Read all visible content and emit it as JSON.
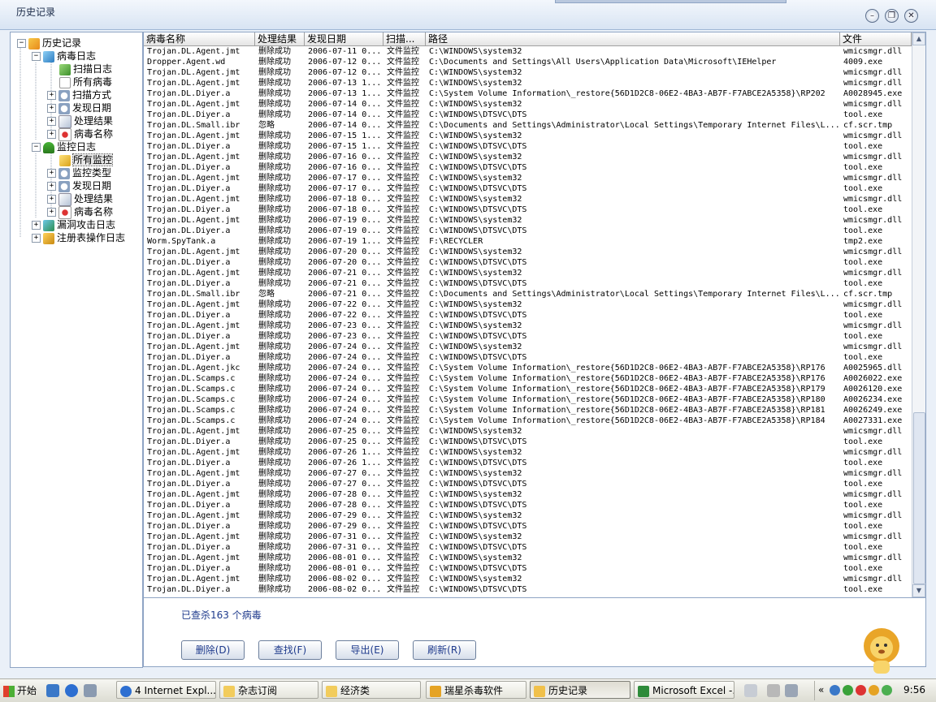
{
  "window": {
    "title": "历史记录"
  },
  "tree": {
    "root": "历史记录",
    "nodes": [
      {
        "label": "病毒日志"
      },
      {
        "label": "扫描日志"
      },
      {
        "label": "所有病毒"
      },
      {
        "label": "扫描方式"
      },
      {
        "label": "发现日期"
      },
      {
        "label": "处理结果"
      },
      {
        "label": "病毒名称"
      },
      {
        "label": "监控日志"
      },
      {
        "label": "所有监控"
      },
      {
        "label": "监控类型"
      },
      {
        "label": "发现日期"
      },
      {
        "label": "处理结果"
      },
      {
        "label": "病毒名称"
      },
      {
        "label": "漏洞攻击日志"
      },
      {
        "label": "注册表操作日志"
      }
    ]
  },
  "table": {
    "columns": [
      "病毒名称",
      "处理结果",
      "发现日期",
      "扫描...",
      "路径",
      "文件"
    ],
    "rows": [
      [
        "Trojan.DL.Agent.jmt",
        "删除成功",
        "2006-07-11 0...",
        "文件监控",
        "C:\\WINDOWS\\system32",
        "wmicsmgr.dll"
      ],
      [
        "Dropper.Agent.wd",
        "删除成功",
        "2006-07-12 0...",
        "文件监控",
        "C:\\Documents and Settings\\All Users\\Application Data\\Microsoft\\IEHelper",
        "4009.exe"
      ],
      [
        "Trojan.DL.Agent.jmt",
        "删除成功",
        "2006-07-12 0...",
        "文件监控",
        "C:\\WINDOWS\\system32",
        "wmicsmgr.dll"
      ],
      [
        "Trojan.DL.Agent.jmt",
        "删除成功",
        "2006-07-13 1...",
        "文件监控",
        "C:\\WINDOWS\\system32",
        "wmicsmgr.dll"
      ],
      [
        "Trojan.DL.Diyer.a",
        "删除成功",
        "2006-07-13 1...",
        "文件监控",
        "C:\\System Volume Information\\_restore{56D1D2C8-06E2-4BA3-AB7F-F7ABCE2A5358}\\RP202",
        "A0028945.exe"
      ],
      [
        "Trojan.DL.Agent.jmt",
        "删除成功",
        "2006-07-14 0...",
        "文件监控",
        "C:\\WINDOWS\\system32",
        "wmicsmgr.dll"
      ],
      [
        "Trojan.DL.Diyer.a",
        "删除成功",
        "2006-07-14 0...",
        "文件监控",
        "C:\\WINDOWS\\DTSVC\\DTS",
        "tool.exe"
      ],
      [
        "Trojan.DL.Small.ibr",
        "忽略",
        "2006-07-14 0...",
        "文件监控",
        "C:\\Documents and Settings\\Administrator\\Local Settings\\Temporary Internet Files\\L...",
        "cf.scr.tmp"
      ],
      [
        "Trojan.DL.Agent.jmt",
        "删除成功",
        "2006-07-15 1...",
        "文件监控",
        "C:\\WINDOWS\\system32",
        "wmicsmgr.dll"
      ],
      [
        "Trojan.DL.Diyer.a",
        "删除成功",
        "2006-07-15 1...",
        "文件监控",
        "C:\\WINDOWS\\DTSVC\\DTS",
        "tool.exe"
      ],
      [
        "Trojan.DL.Agent.jmt",
        "删除成功",
        "2006-07-16 0...",
        "文件监控",
        "C:\\WINDOWS\\system32",
        "wmicsmgr.dll"
      ],
      [
        "Trojan.DL.Diyer.a",
        "删除成功",
        "2006-07-16 0...",
        "文件监控",
        "C:\\WINDOWS\\DTSVC\\DTS",
        "tool.exe"
      ],
      [
        "Trojan.DL.Agent.jmt",
        "删除成功",
        "2006-07-17 0...",
        "文件监控",
        "C:\\WINDOWS\\system32",
        "wmicsmgr.dll"
      ],
      [
        "Trojan.DL.Diyer.a",
        "删除成功",
        "2006-07-17 0...",
        "文件监控",
        "C:\\WINDOWS\\DTSVC\\DTS",
        "tool.exe"
      ],
      [
        "Trojan.DL.Agent.jmt",
        "删除成功",
        "2006-07-18 0...",
        "文件监控",
        "C:\\WINDOWS\\system32",
        "wmicsmgr.dll"
      ],
      [
        "Trojan.DL.Diyer.a",
        "删除成功",
        "2006-07-18 0...",
        "文件监控",
        "C:\\WINDOWS\\DTSVC\\DTS",
        "tool.exe"
      ],
      [
        "Trojan.DL.Agent.jmt",
        "删除成功",
        "2006-07-19 0...",
        "文件监控",
        "C:\\WINDOWS\\system32",
        "wmicsmgr.dll"
      ],
      [
        "Trojan.DL.Diyer.a",
        "删除成功",
        "2006-07-19 0...",
        "文件监控",
        "C:\\WINDOWS\\DTSVC\\DTS",
        "tool.exe"
      ],
      [
        "Worm.SpyTank.a",
        "删除成功",
        "2006-07-19 1...",
        "文件监控",
        "F:\\RECYCLER",
        "tmp2.exe"
      ],
      [
        "Trojan.DL.Agent.jmt",
        "删除成功",
        "2006-07-20 0...",
        "文件监控",
        "C:\\WINDOWS\\system32",
        "wmicsmgr.dll"
      ],
      [
        "Trojan.DL.Diyer.a",
        "删除成功",
        "2006-07-20 0...",
        "文件监控",
        "C:\\WINDOWS\\DTSVC\\DTS",
        "tool.exe"
      ],
      [
        "Trojan.DL.Agent.jmt",
        "删除成功",
        "2006-07-21 0...",
        "文件监控",
        "C:\\WINDOWS\\system32",
        "wmicsmgr.dll"
      ],
      [
        "Trojan.DL.Diyer.a",
        "删除成功",
        "2006-07-21 0...",
        "文件监控",
        "C:\\WINDOWS\\DTSVC\\DTS",
        "tool.exe"
      ],
      [
        "Trojan.DL.Small.ibr",
        "忽略",
        "2006-07-21 0...",
        "文件监控",
        "C:\\Documents and Settings\\Administrator\\Local Settings\\Temporary Internet Files\\L...",
        "cf.scr.tmp"
      ],
      [
        "Trojan.DL.Agent.jmt",
        "删除成功",
        "2006-07-22 0...",
        "文件监控",
        "C:\\WINDOWS\\system32",
        "wmicsmgr.dll"
      ],
      [
        "Trojan.DL.Diyer.a",
        "删除成功",
        "2006-07-22 0...",
        "文件监控",
        "C:\\WINDOWS\\DTSVC\\DTS",
        "tool.exe"
      ],
      [
        "Trojan.DL.Agent.jmt",
        "删除成功",
        "2006-07-23 0...",
        "文件监控",
        "C:\\WINDOWS\\system32",
        "wmicsmgr.dll"
      ],
      [
        "Trojan.DL.Diyer.a",
        "删除成功",
        "2006-07-23 0...",
        "文件监控",
        "C:\\WINDOWS\\DTSVC\\DTS",
        "tool.exe"
      ],
      [
        "Trojan.DL.Agent.jmt",
        "删除成功",
        "2006-07-24 0...",
        "文件监控",
        "C:\\WINDOWS\\system32",
        "wmicsmgr.dll"
      ],
      [
        "Trojan.DL.Diyer.a",
        "删除成功",
        "2006-07-24 0...",
        "文件监控",
        "C:\\WINDOWS\\DTSVC\\DTS",
        "tool.exe"
      ],
      [
        "Trojan.DL.Agent.jkc",
        "删除成功",
        "2006-07-24 0...",
        "文件监控",
        "C:\\System Volume Information\\_restore{56D1D2C8-06E2-4BA3-AB7F-F7ABCE2A5358}\\RP176",
        "A0025965.dll"
      ],
      [
        "Trojan.DL.Scamps.c",
        "删除成功",
        "2006-07-24 0...",
        "文件监控",
        "C:\\System Volume Information\\_restore{56D1D2C8-06E2-4BA3-AB7F-F7ABCE2A5358}\\RP176",
        "A0026022.exe"
      ],
      [
        "Trojan.DL.Scamps.c",
        "删除成功",
        "2006-07-24 0...",
        "文件监控",
        "C:\\System Volume Information\\_restore{56D1D2C8-06E2-4BA3-AB7F-F7ABCE2A5358}\\RP179",
        "A0026120.exe"
      ],
      [
        "Trojan.DL.Scamps.c",
        "删除成功",
        "2006-07-24 0...",
        "文件监控",
        "C:\\System Volume Information\\_restore{56D1D2C8-06E2-4BA3-AB7F-F7ABCE2A5358}\\RP180",
        "A0026234.exe"
      ],
      [
        "Trojan.DL.Scamps.c",
        "删除成功",
        "2006-07-24 0...",
        "文件监控",
        "C:\\System Volume Information\\_restore{56D1D2C8-06E2-4BA3-AB7F-F7ABCE2A5358}\\RP181",
        "A0026249.exe"
      ],
      [
        "Trojan.DL.Scamps.c",
        "删除成功",
        "2006-07-24 0...",
        "文件监控",
        "C:\\System Volume Information\\_restore{56D1D2C8-06E2-4BA3-AB7F-F7ABCE2A5358}\\RP184",
        "A0027331.exe"
      ],
      [
        "Trojan.DL.Agent.jmt",
        "删除成功",
        "2006-07-25 0...",
        "文件监控",
        "C:\\WINDOWS\\system32",
        "wmicsmgr.dll"
      ],
      [
        "Trojan.DL.Diyer.a",
        "删除成功",
        "2006-07-25 0...",
        "文件监控",
        "C:\\WINDOWS\\DTSVC\\DTS",
        "tool.exe"
      ],
      [
        "Trojan.DL.Agent.jmt",
        "删除成功",
        "2006-07-26 1...",
        "文件监控",
        "C:\\WINDOWS\\system32",
        "wmicsmgr.dll"
      ],
      [
        "Trojan.DL.Diyer.a",
        "删除成功",
        "2006-07-26 1...",
        "文件监控",
        "C:\\WINDOWS\\DTSVC\\DTS",
        "tool.exe"
      ],
      [
        "Trojan.DL.Agent.jmt",
        "删除成功",
        "2006-07-27 0...",
        "文件监控",
        "C:\\WINDOWS\\system32",
        "wmicsmgr.dll"
      ],
      [
        "Trojan.DL.Diyer.a",
        "删除成功",
        "2006-07-27 0...",
        "文件监控",
        "C:\\WINDOWS\\DTSVC\\DTS",
        "tool.exe"
      ],
      [
        "Trojan.DL.Agent.jmt",
        "删除成功",
        "2006-07-28 0...",
        "文件监控",
        "C:\\WINDOWS\\system32",
        "wmicsmgr.dll"
      ],
      [
        "Trojan.DL.Diyer.a",
        "删除成功",
        "2006-07-28 0...",
        "文件监控",
        "C:\\WINDOWS\\DTSVC\\DTS",
        "tool.exe"
      ],
      [
        "Trojan.DL.Agent.jmt",
        "删除成功",
        "2006-07-29 0...",
        "文件监控",
        "C:\\WINDOWS\\system32",
        "wmicsmgr.dll"
      ],
      [
        "Trojan.DL.Diyer.a",
        "删除成功",
        "2006-07-29 0...",
        "文件监控",
        "C:\\WINDOWS\\DTSVC\\DTS",
        "tool.exe"
      ],
      [
        "Trojan.DL.Agent.jmt",
        "删除成功",
        "2006-07-31 0...",
        "文件监控",
        "C:\\WINDOWS\\system32",
        "wmicsmgr.dll"
      ],
      [
        "Trojan.DL.Diyer.a",
        "删除成功",
        "2006-07-31 0...",
        "文件监控",
        "C:\\WINDOWS\\DTSVC\\DTS",
        "tool.exe"
      ],
      [
        "Trojan.DL.Agent.jmt",
        "删除成功",
        "2006-08-01 0...",
        "文件监控",
        "C:\\WINDOWS\\system32",
        "wmicsmgr.dll"
      ],
      [
        "Trojan.DL.Diyer.a",
        "删除成功",
        "2006-08-01 0...",
        "文件监控",
        "C:\\WINDOWS\\DTSVC\\DTS",
        "tool.exe"
      ],
      [
        "Trojan.DL.Agent.jmt",
        "删除成功",
        "2006-08-02 0...",
        "文件监控",
        "C:\\WINDOWS\\system32",
        "wmicsmgr.dll"
      ],
      [
        "Trojan.DL.Diyer.a",
        "删除成功",
        "2006-08-02 0...",
        "文件监控",
        "C:\\WINDOWS\\DTSVC\\DTS",
        "tool.exe"
      ]
    ]
  },
  "status": {
    "count_text": "已查杀163 个病毒"
  },
  "buttons": {
    "delete": "删除(D)",
    "find": "查找(F)",
    "export": "导出(E)",
    "refresh": "刷新(R)"
  },
  "taskbar": {
    "start": "开始",
    "items": [
      "4 Internet Expl...",
      "杂志订阅",
      "经济类",
      "瑞星杀毒软件",
      "历史记录",
      "Microsoft Excel -..."
    ],
    "clock": "9:56"
  },
  "colors": {
    "accent": "#1e3a8c",
    "window_bg": "#eaf0f8",
    "border": "#8ea4c4"
  },
  "icons": {
    "minimize": "minimize-icon",
    "restore": "restore-icon",
    "close": "close-icon",
    "mascot": "lion-mascot"
  }
}
